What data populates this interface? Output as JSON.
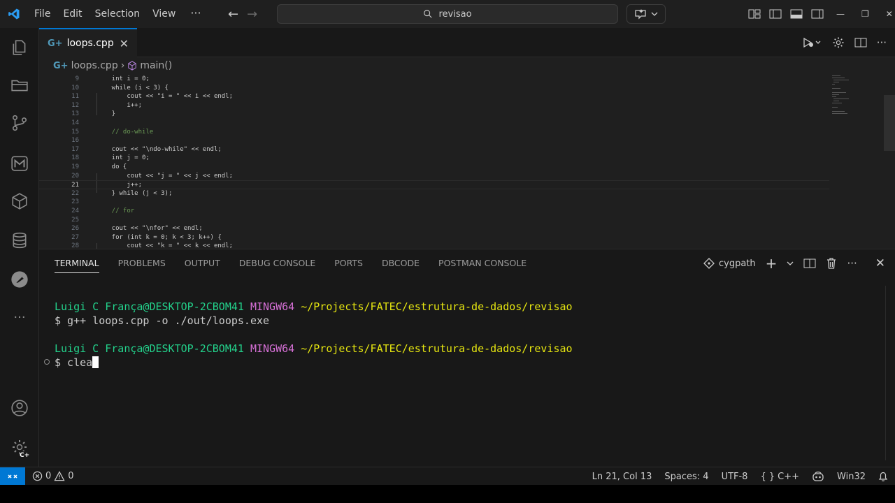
{
  "menu": {
    "file": "File",
    "edit": "Edit",
    "selection": "Selection",
    "view": "View",
    "more": "···"
  },
  "search": {
    "text": "revisao"
  },
  "tab": {
    "filename": "loops.cpp"
  },
  "breadcrumb": {
    "file": "loops.cpp",
    "separator": "›",
    "symbol": "main()"
  },
  "editor": {
    "lines": [
      {
        "num": "9",
        "text": "    int i = 0;"
      },
      {
        "num": "10",
        "text": "    while (i < 3) {"
      },
      {
        "num": "11",
        "text": "        cout << \"i = \" << i << endl;"
      },
      {
        "num": "12",
        "text": "        i++;"
      },
      {
        "num": "13",
        "text": "    }"
      },
      {
        "num": "14",
        "text": ""
      },
      {
        "num": "15",
        "text": "    // do-while"
      },
      {
        "num": "16",
        "text": ""
      },
      {
        "num": "17",
        "text": "    cout << \"\\ndo-while\" << endl;"
      },
      {
        "num": "18",
        "text": "    int j = 0;"
      },
      {
        "num": "19",
        "text": "    do {"
      },
      {
        "num": "20",
        "text": "        cout << \"j = \" << j << endl;"
      },
      {
        "num": "21",
        "text": "        j++;"
      },
      {
        "num": "22",
        "text": "    } while (j < 3);"
      },
      {
        "num": "23",
        "text": ""
      },
      {
        "num": "24",
        "text": "    // for"
      },
      {
        "num": "25",
        "text": ""
      },
      {
        "num": "26",
        "text": "    cout << \"\\nfor\" << endl;"
      },
      {
        "num": "27",
        "text": "    for (int k = 0; k < 3; k++) {"
      },
      {
        "num": "28",
        "text": "        cout << \"k = \" << k << endl;"
      }
    ]
  },
  "panel": {
    "tabs": [
      "TERMINAL",
      "PROBLEMS",
      "OUTPUT",
      "DEBUG CONSOLE",
      "PORTS",
      "DBCODE",
      "POSTMAN CONSOLE"
    ],
    "terminal_name": "cygpath"
  },
  "terminal": {
    "prompt1": {
      "user": "Luigi C França@DESKTOP-2CBOM41",
      "sys": "MINGW64",
      "path": "~/Projects/FATEC/estrutura-de-dados/revisao"
    },
    "cmd1": "$ g++ loops.cpp -o ./out/loops.exe",
    "prompt2": {
      "user": "Luigi C França@DESKTOP-2CBOM41",
      "sys": "MINGW64",
      "path": "~/Projects/FATEC/estrutura-de-dados/revisao"
    },
    "cmd2": "$ clear"
  },
  "status": {
    "errors": "0",
    "warnings": "0",
    "position": "Ln 21, Col 13",
    "spaces": "Spaces: 4",
    "encoding": "UTF-8",
    "language": "C++",
    "platform": "Win32"
  },
  "colors": {
    "accent": "#0078d4",
    "terminal_user": "#23d18b",
    "terminal_sys": "#d670d6",
    "terminal_path": "#e5e510"
  }
}
